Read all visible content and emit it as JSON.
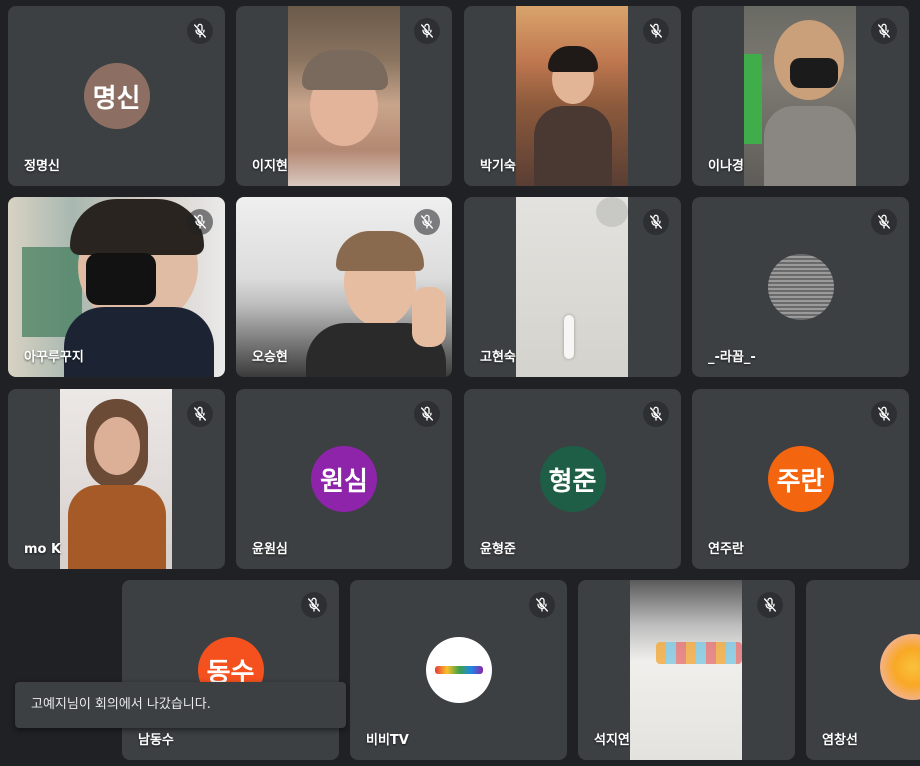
{
  "participants": [
    {
      "name": "정명신",
      "avatar_text": "명신",
      "avatar_color": "#8d6e63"
    },
    {
      "name": "이지현"
    },
    {
      "name": "박기숙"
    },
    {
      "name": "이나경"
    },
    {
      "name": "아꾸루꾸지"
    },
    {
      "name": "오승현"
    },
    {
      "name": "고현숙"
    },
    {
      "name": "_-라꼽_-"
    },
    {
      "name": "mo K"
    },
    {
      "name": "윤원심",
      "avatar_text": "원심",
      "avatar_color": "#8e24aa"
    },
    {
      "name": "윤형준",
      "avatar_text": "형준",
      "avatar_color": "#1e5d46"
    },
    {
      "name": "연주란",
      "avatar_text": "주란",
      "avatar_color": "#f4650f"
    },
    {
      "name": "남동수",
      "avatar_text": "동수",
      "avatar_color": "#f4511e"
    },
    {
      "name": "비비TV"
    },
    {
      "name": "석지연"
    },
    {
      "name": "염창선"
    }
  ],
  "toast": {
    "message": "고예지님이 회의에서 나갔습니다."
  },
  "icons": {
    "mute": "microphone-off-icon"
  }
}
